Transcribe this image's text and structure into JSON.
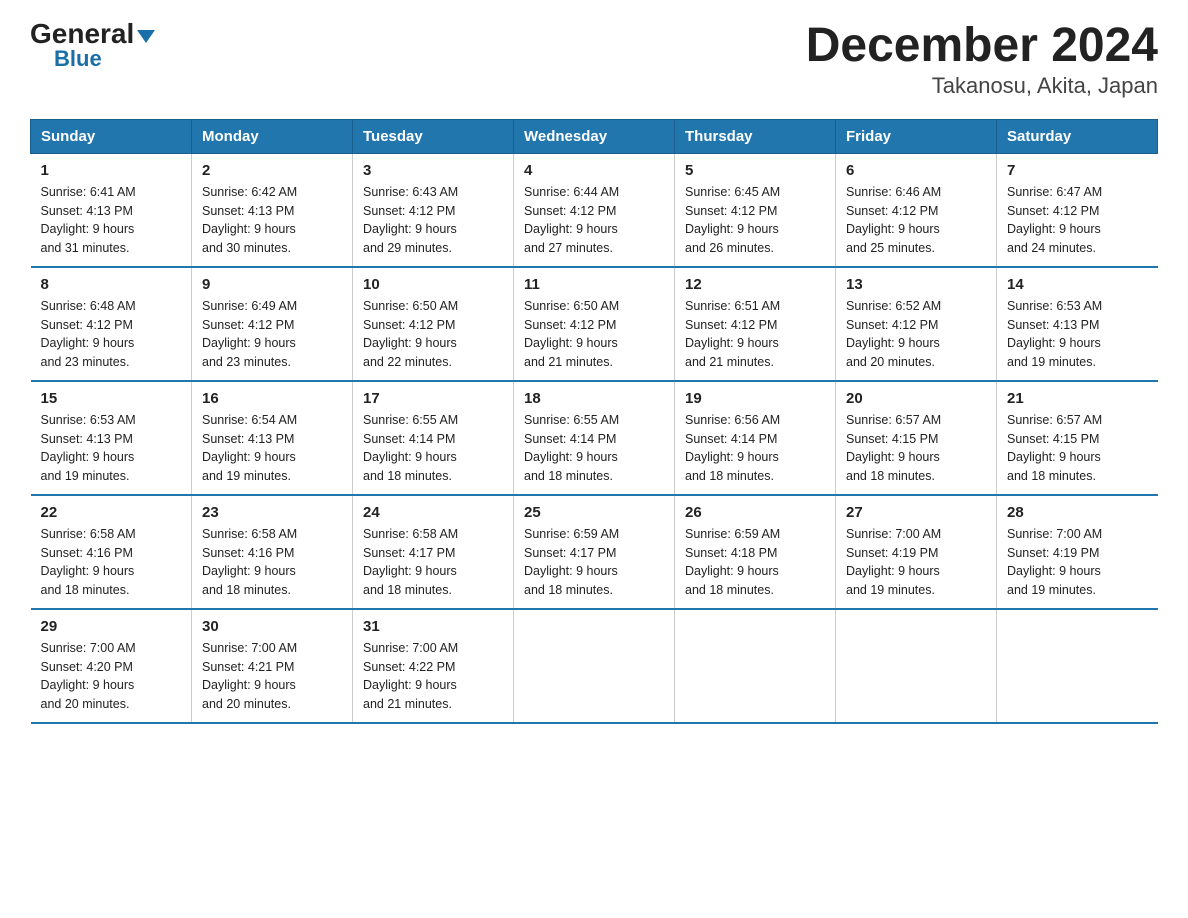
{
  "logo": {
    "general": "General",
    "blue": "Blue",
    "triangle": true
  },
  "title": "December 2024",
  "subtitle": "Takanosu, Akita, Japan",
  "headers": [
    "Sunday",
    "Monday",
    "Tuesday",
    "Wednesday",
    "Thursday",
    "Friday",
    "Saturday"
  ],
  "weeks": [
    [
      {
        "day": "1",
        "sunrise": "6:41 AM",
        "sunset": "4:13 PM",
        "daylight": "9 hours and 31 minutes."
      },
      {
        "day": "2",
        "sunrise": "6:42 AM",
        "sunset": "4:13 PM",
        "daylight": "9 hours and 30 minutes."
      },
      {
        "day": "3",
        "sunrise": "6:43 AM",
        "sunset": "4:12 PM",
        "daylight": "9 hours and 29 minutes."
      },
      {
        "day": "4",
        "sunrise": "6:44 AM",
        "sunset": "4:12 PM",
        "daylight": "9 hours and 27 minutes."
      },
      {
        "day": "5",
        "sunrise": "6:45 AM",
        "sunset": "4:12 PM",
        "daylight": "9 hours and 26 minutes."
      },
      {
        "day": "6",
        "sunrise": "6:46 AM",
        "sunset": "4:12 PM",
        "daylight": "9 hours and 25 minutes."
      },
      {
        "day": "7",
        "sunrise": "6:47 AM",
        "sunset": "4:12 PM",
        "daylight": "9 hours and 24 minutes."
      }
    ],
    [
      {
        "day": "8",
        "sunrise": "6:48 AM",
        "sunset": "4:12 PM",
        "daylight": "9 hours and 23 minutes."
      },
      {
        "day": "9",
        "sunrise": "6:49 AM",
        "sunset": "4:12 PM",
        "daylight": "9 hours and 23 minutes."
      },
      {
        "day": "10",
        "sunrise": "6:50 AM",
        "sunset": "4:12 PM",
        "daylight": "9 hours and 22 minutes."
      },
      {
        "day": "11",
        "sunrise": "6:50 AM",
        "sunset": "4:12 PM",
        "daylight": "9 hours and 21 minutes."
      },
      {
        "day": "12",
        "sunrise": "6:51 AM",
        "sunset": "4:12 PM",
        "daylight": "9 hours and 21 minutes."
      },
      {
        "day": "13",
        "sunrise": "6:52 AM",
        "sunset": "4:12 PM",
        "daylight": "9 hours and 20 minutes."
      },
      {
        "day": "14",
        "sunrise": "6:53 AM",
        "sunset": "4:13 PM",
        "daylight": "9 hours and 19 minutes."
      }
    ],
    [
      {
        "day": "15",
        "sunrise": "6:53 AM",
        "sunset": "4:13 PM",
        "daylight": "9 hours and 19 minutes."
      },
      {
        "day": "16",
        "sunrise": "6:54 AM",
        "sunset": "4:13 PM",
        "daylight": "9 hours and 19 minutes."
      },
      {
        "day": "17",
        "sunrise": "6:55 AM",
        "sunset": "4:14 PM",
        "daylight": "9 hours and 18 minutes."
      },
      {
        "day": "18",
        "sunrise": "6:55 AM",
        "sunset": "4:14 PM",
        "daylight": "9 hours and 18 minutes."
      },
      {
        "day": "19",
        "sunrise": "6:56 AM",
        "sunset": "4:14 PM",
        "daylight": "9 hours and 18 minutes."
      },
      {
        "day": "20",
        "sunrise": "6:57 AM",
        "sunset": "4:15 PM",
        "daylight": "9 hours and 18 minutes."
      },
      {
        "day": "21",
        "sunrise": "6:57 AM",
        "sunset": "4:15 PM",
        "daylight": "9 hours and 18 minutes."
      }
    ],
    [
      {
        "day": "22",
        "sunrise": "6:58 AM",
        "sunset": "4:16 PM",
        "daylight": "9 hours and 18 minutes."
      },
      {
        "day": "23",
        "sunrise": "6:58 AM",
        "sunset": "4:16 PM",
        "daylight": "9 hours and 18 minutes."
      },
      {
        "day": "24",
        "sunrise": "6:58 AM",
        "sunset": "4:17 PM",
        "daylight": "9 hours and 18 minutes."
      },
      {
        "day": "25",
        "sunrise": "6:59 AM",
        "sunset": "4:17 PM",
        "daylight": "9 hours and 18 minutes."
      },
      {
        "day": "26",
        "sunrise": "6:59 AM",
        "sunset": "4:18 PM",
        "daylight": "9 hours and 18 minutes."
      },
      {
        "day": "27",
        "sunrise": "7:00 AM",
        "sunset": "4:19 PM",
        "daylight": "9 hours and 19 minutes."
      },
      {
        "day": "28",
        "sunrise": "7:00 AM",
        "sunset": "4:19 PM",
        "daylight": "9 hours and 19 minutes."
      }
    ],
    [
      {
        "day": "29",
        "sunrise": "7:00 AM",
        "sunset": "4:20 PM",
        "daylight": "9 hours and 20 minutes."
      },
      {
        "day": "30",
        "sunrise": "7:00 AM",
        "sunset": "4:21 PM",
        "daylight": "9 hours and 20 minutes."
      },
      {
        "day": "31",
        "sunrise": "7:00 AM",
        "sunset": "4:22 PM",
        "daylight": "9 hours and 21 minutes."
      },
      null,
      null,
      null,
      null
    ]
  ]
}
